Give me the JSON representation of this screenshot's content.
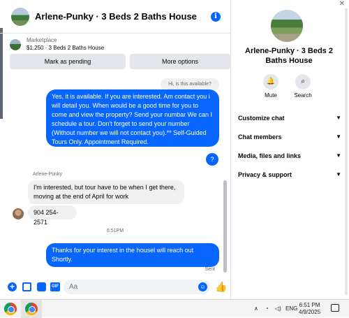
{
  "chat": {
    "title": "Arlene-Punky · 3 Beds 2 Baths House",
    "marketplace": {
      "label": "Marketplace",
      "listing": "$1,250 · 3 Beds 2 Baths House",
      "pending_button": "Mark as pending",
      "more_button": "More options"
    },
    "messages": {
      "reply_preview": "Hi, is this available?",
      "outgoing_1": "Yes, it is available. If you are interested.  Am contact you i will detail you.  When would be a good time for you to come and view the property? Send your numbar We can I schedule a tour.  Don't forget to send your number (Without number we will not contact you).** Self-Guided Tours Only. Appointment Required.",
      "outgoing_q": "?",
      "sender": "Arlene-Punky",
      "incoming_1": "I'm interested, but tour have to be when I get there, moving at the end of April  for work",
      "incoming_2": "904 254-2571",
      "timestamp": "6:51PM",
      "outgoing_2": "Thanks for your interest in the housel will reach out Shortly.",
      "status": "Sent"
    },
    "composer": {
      "placeholder": "Aa"
    }
  },
  "details": {
    "name": "Arlene-Punky · 3 Beds 2 Baths House",
    "mute_label": "Mute",
    "search_label": "Search",
    "sections": [
      "Customize chat",
      "Chat members",
      "Media, files and links",
      "Privacy & support"
    ]
  },
  "taskbar": {
    "language": "ENG",
    "time": "6:51 PM",
    "date": "4/9/2025"
  },
  "colors": {
    "accent": "#0866ff",
    "bubble_in": "#f0f0f0",
    "button_bg": "#e4e6eb"
  }
}
